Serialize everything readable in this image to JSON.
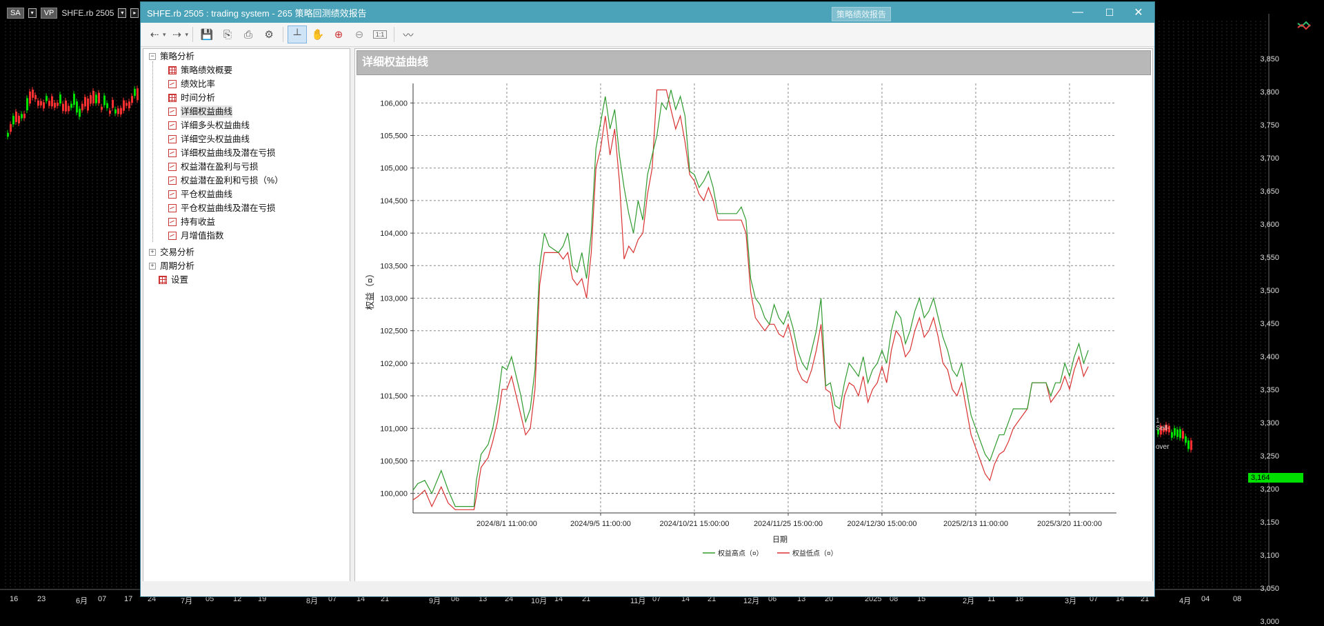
{
  "background": {
    "chips": [
      "SA",
      "VP"
    ],
    "symbol": "SHFE.rb 2505",
    "price_labels": [
      "3,850",
      "3,800",
      "3,750",
      "3,700",
      "3,650",
      "3,600",
      "3,550",
      "3,500",
      "3,450",
      "3,400",
      "3,350",
      "3,300",
      "3,250",
      "3,200",
      "3,150",
      "3,100",
      "3,050",
      "3,000"
    ],
    "current_price": "3,164",
    "time_labels": [
      "16",
      "23",
      "6月",
      "07",
      "17",
      "24",
      "7月",
      "05",
      "12",
      "19",
      "8月",
      "07",
      "14",
      "21",
      "9月",
      "06",
      "13",
      "24",
      "10月",
      "14",
      "21",
      "11月",
      "07",
      "14",
      "21",
      "12月",
      "06",
      "13",
      "20",
      "2025",
      "08",
      "15",
      "2月",
      "11",
      "18",
      "3月",
      "07",
      "14",
      "21",
      "4月",
      "04",
      "08"
    ],
    "right_panel_text": [
      "1",
      "Sell-",
      "over"
    ]
  },
  "window": {
    "title": "SHFE.rb 2505 : trading system - 265 策略回测绩效报告",
    "ghost_button": "策略绩效报告",
    "controls": {
      "minimize": "—",
      "maximize": "☐",
      "close": "✕"
    }
  },
  "toolbar": {
    "icons": [
      "back-icon",
      "dropdown-icon",
      "forward-icon",
      "dropdown-icon",
      "save-icon",
      "export-icon",
      "print-icon",
      "settings-icon",
      "crosshair-icon",
      "hand-icon",
      "zoom-in-icon",
      "zoom-out-icon",
      "actual-size-icon",
      "chart-style-icon"
    ],
    "actual_size_label": "1:1"
  },
  "tree": {
    "root": "策略分析",
    "children": [
      "策略绩效概要",
      "绩效比率",
      "时间分析",
      "详细权益曲线",
      "详细多头权益曲线",
      "详细空头权益曲线",
      "详细权益曲线及潜在亏损",
      "权益潜在盈利与亏损",
      "权益潜在盈利和亏损（%）",
      "平仓权益曲线",
      "平仓权益曲线及潜在亏损",
      "持有收益",
      "月增值指数"
    ],
    "selected": "详细权益曲线",
    "others": [
      "交易分析",
      "周期分析",
      "设置"
    ]
  },
  "report": {
    "header": "详细权益曲线"
  },
  "chart_data": {
    "type": "line",
    "ylabel": "权益（¤）",
    "xlabel": "日期",
    "ylim": [
      99700,
      106300
    ],
    "yticks": [
      100000,
      100500,
      101000,
      101500,
      102000,
      102500,
      103000,
      103500,
      104000,
      104500,
      105000,
      105500,
      106000
    ],
    "ytick_labels": [
      "100,000",
      "100,500",
      "101,000",
      "101,500",
      "102,000",
      "102,500",
      "103,000",
      "103,500",
      "104,000",
      "104,500",
      "105,000",
      "105,500",
      "106,000"
    ],
    "xlim": [
      0,
      300
    ],
    "xticks": [
      40,
      80,
      120,
      160,
      200,
      240,
      280
    ],
    "xtick_labels": [
      "2024/8/1 11:00:00",
      "2024/9/5 11:00:00",
      "2024/10/21 15:00:00",
      "2024/11/25 15:00:00",
      "2024/12/30 15:00:00",
      "2025/2/13 11:00:00",
      "2025/3/20 11:00:00"
    ],
    "grid": true,
    "legend_position": "bottom",
    "series": [
      {
        "name": "权益高点（¤）",
        "color": "#2e9a2e",
        "points": [
          [
            0,
            100050
          ],
          [
            2,
            100150
          ],
          [
            5,
            100200
          ],
          [
            8,
            100000
          ],
          [
            12,
            100350
          ],
          [
            15,
            100050
          ],
          [
            18,
            99800
          ],
          [
            21,
            99800
          ],
          [
            26,
            99800
          ],
          [
            27,
            100200
          ],
          [
            29,
            100600
          ],
          [
            32,
            100750
          ],
          [
            34,
            101000
          ],
          [
            36,
            101400
          ],
          [
            38,
            101950
          ],
          [
            40,
            101900
          ],
          [
            42,
            102100
          ],
          [
            44,
            101800
          ],
          [
            46,
            101500
          ],
          [
            48,
            101100
          ],
          [
            50,
            101300
          ],
          [
            52,
            101900
          ],
          [
            54,
            103500
          ],
          [
            56,
            104000
          ],
          [
            58,
            103800
          ],
          [
            62,
            103700
          ],
          [
            64,
            103800
          ],
          [
            66,
            104000
          ],
          [
            68,
            103500
          ],
          [
            70,
            103400
          ],
          [
            72,
            103700
          ],
          [
            74,
            103300
          ],
          [
            76,
            104000
          ],
          [
            78,
            105300
          ],
          [
            80,
            105700
          ],
          [
            82,
            106100
          ],
          [
            84,
            105600
          ],
          [
            86,
            105900
          ],
          [
            88,
            105200
          ],
          [
            90,
            104700
          ],
          [
            92,
            104300
          ],
          [
            94,
            104000
          ],
          [
            96,
            104500
          ],
          [
            98,
            104200
          ],
          [
            100,
            104900
          ],
          [
            102,
            105200
          ],
          [
            104,
            105500
          ],
          [
            106,
            106000
          ],
          [
            108,
            105900
          ],
          [
            110,
            106200
          ],
          [
            112,
            105900
          ],
          [
            114,
            106100
          ],
          [
            116,
            105800
          ],
          [
            118,
            104950
          ],
          [
            120,
            104900
          ],
          [
            122,
            104700
          ],
          [
            124,
            104800
          ],
          [
            126,
            104950
          ],
          [
            128,
            104700
          ],
          [
            130,
            104300
          ],
          [
            138,
            104300
          ],
          [
            140,
            104400
          ],
          [
            142,
            104200
          ],
          [
            144,
            103300
          ],
          [
            146,
            103000
          ],
          [
            148,
            102900
          ],
          [
            150,
            102700
          ],
          [
            152,
            102600
          ],
          [
            154,
            102900
          ],
          [
            156,
            102700
          ],
          [
            158,
            102600
          ],
          [
            160,
            102800
          ],
          [
            162,
            102550
          ],
          [
            164,
            102200
          ],
          [
            166,
            102000
          ],
          [
            168,
            101900
          ],
          [
            170,
            102200
          ],
          [
            172,
            102500
          ],
          [
            174,
            103000
          ],
          [
            176,
            101650
          ],
          [
            178,
            101700
          ],
          [
            180,
            101350
          ],
          [
            182,
            101300
          ],
          [
            184,
            101700
          ],
          [
            186,
            102000
          ],
          [
            188,
            101900
          ],
          [
            190,
            101800
          ],
          [
            192,
            102100
          ],
          [
            194,
            101700
          ],
          [
            196,
            101900
          ],
          [
            198,
            102000
          ],
          [
            200,
            102200
          ],
          [
            202,
            102000
          ],
          [
            204,
            102500
          ],
          [
            206,
            102800
          ],
          [
            208,
            102700
          ],
          [
            210,
            102300
          ],
          [
            212,
            102500
          ],
          [
            214,
            102800
          ],
          [
            216,
            103000
          ],
          [
            218,
            102700
          ],
          [
            220,
            102800
          ],
          [
            222,
            103000
          ],
          [
            224,
            102700
          ],
          [
            226,
            102400
          ],
          [
            228,
            102200
          ],
          [
            230,
            101900
          ],
          [
            232,
            101800
          ],
          [
            234,
            102000
          ],
          [
            236,
            101600
          ],
          [
            238,
            101200
          ],
          [
            240,
            101000
          ],
          [
            242,
            100800
          ],
          [
            244,
            100600
          ],
          [
            246,
            100500
          ],
          [
            248,
            100700
          ],
          [
            250,
            100900
          ],
          [
            252,
            100900
          ],
          [
            254,
            101100
          ],
          [
            256,
            101300
          ],
          [
            262,
            101300
          ],
          [
            264,
            101700
          ],
          [
            270,
            101700
          ],
          [
            272,
            101500
          ],
          [
            274,
            101700
          ],
          [
            276,
            101700
          ],
          [
            278,
            102000
          ],
          [
            280,
            101800
          ],
          [
            282,
            102100
          ],
          [
            284,
            102300
          ],
          [
            286,
            102000
          ],
          [
            288,
            102200
          ]
        ]
      },
      {
        "name": "权益低点（¤）",
        "color": "#d93030",
        "points": [
          [
            0,
            99900
          ],
          [
            2,
            99950
          ],
          [
            5,
            100050
          ],
          [
            8,
            99800
          ],
          [
            12,
            100100
          ],
          [
            15,
            99850
          ],
          [
            18,
            99750
          ],
          [
            21,
            99750
          ],
          [
            26,
            99750
          ],
          [
            27,
            99950
          ],
          [
            29,
            100400
          ],
          [
            32,
            100550
          ],
          [
            34,
            100800
          ],
          [
            36,
            101100
          ],
          [
            38,
            101600
          ],
          [
            40,
            101600
          ],
          [
            42,
            101800
          ],
          [
            44,
            101500
          ],
          [
            46,
            101200
          ],
          [
            48,
            100900
          ],
          [
            50,
            101000
          ],
          [
            52,
            101600
          ],
          [
            54,
            103200
          ],
          [
            56,
            103700
          ],
          [
            58,
            103700
          ],
          [
            62,
            103700
          ],
          [
            64,
            103600
          ],
          [
            66,
            103700
          ],
          [
            68,
            103300
          ],
          [
            70,
            103200
          ],
          [
            72,
            103300
          ],
          [
            74,
            103000
          ],
          [
            76,
            103700
          ],
          [
            78,
            105000
          ],
          [
            80,
            105300
          ],
          [
            82,
            105800
          ],
          [
            84,
            105200
          ],
          [
            86,
            105600
          ],
          [
            88,
            104800
          ],
          [
            90,
            103600
          ],
          [
            92,
            103800
          ],
          [
            94,
            103700
          ],
          [
            96,
            103900
          ],
          [
            98,
            104000
          ],
          [
            100,
            104600
          ],
          [
            102,
            105000
          ],
          [
            104,
            106200
          ],
          [
            106,
            106200
          ],
          [
            108,
            106200
          ],
          [
            110,
            105900
          ],
          [
            112,
            105600
          ],
          [
            114,
            105800
          ],
          [
            116,
            105400
          ],
          [
            118,
            104900
          ],
          [
            120,
            104800
          ],
          [
            122,
            104600
          ],
          [
            124,
            104500
          ],
          [
            126,
            104700
          ],
          [
            128,
            104500
          ],
          [
            130,
            104200
          ],
          [
            138,
            104200
          ],
          [
            140,
            104200
          ],
          [
            142,
            104000
          ],
          [
            144,
            103100
          ],
          [
            146,
            102700
          ],
          [
            148,
            102600
          ],
          [
            150,
            102500
          ],
          [
            152,
            102600
          ],
          [
            154,
            102600
          ],
          [
            156,
            102450
          ],
          [
            158,
            102400
          ],
          [
            160,
            102600
          ],
          [
            162,
            102300
          ],
          [
            164,
            101900
          ],
          [
            166,
            101750
          ],
          [
            168,
            101700
          ],
          [
            170,
            101900
          ],
          [
            172,
            102200
          ],
          [
            174,
            102600
          ],
          [
            176,
            101600
          ],
          [
            178,
            101550
          ],
          [
            180,
            101100
          ],
          [
            182,
            101000
          ],
          [
            184,
            101500
          ],
          [
            186,
            101700
          ],
          [
            188,
            101650
          ],
          [
            190,
            101500
          ],
          [
            192,
            101800
          ],
          [
            194,
            101400
          ],
          [
            196,
            101600
          ],
          [
            198,
            101700
          ],
          [
            200,
            101950
          ],
          [
            202,
            101700
          ],
          [
            204,
            102200
          ],
          [
            206,
            102500
          ],
          [
            208,
            102400
          ],
          [
            210,
            102100
          ],
          [
            212,
            102200
          ],
          [
            214,
            102500
          ],
          [
            216,
            102700
          ],
          [
            218,
            102400
          ],
          [
            220,
            102500
          ],
          [
            222,
            102700
          ],
          [
            224,
            102400
          ],
          [
            226,
            102000
          ],
          [
            228,
            101900
          ],
          [
            230,
            101600
          ],
          [
            232,
            101500
          ],
          [
            234,
            101700
          ],
          [
            236,
            101300
          ],
          [
            238,
            100900
          ],
          [
            240,
            100700
          ],
          [
            242,
            100500
          ],
          [
            244,
            100300
          ],
          [
            246,
            100200
          ],
          [
            248,
            100450
          ],
          [
            250,
            100600
          ],
          [
            252,
            100650
          ],
          [
            254,
            100800
          ],
          [
            256,
            101000
          ],
          [
            262,
            101300
          ],
          [
            264,
            101700
          ],
          [
            270,
            101700
          ],
          [
            272,
            101400
          ],
          [
            274,
            101500
          ],
          [
            276,
            101600
          ],
          [
            278,
            101800
          ],
          [
            280,
            101600
          ],
          [
            282,
            101900
          ],
          [
            284,
            102100
          ],
          [
            286,
            101800
          ],
          [
            288,
            101950
          ]
        ]
      }
    ]
  }
}
